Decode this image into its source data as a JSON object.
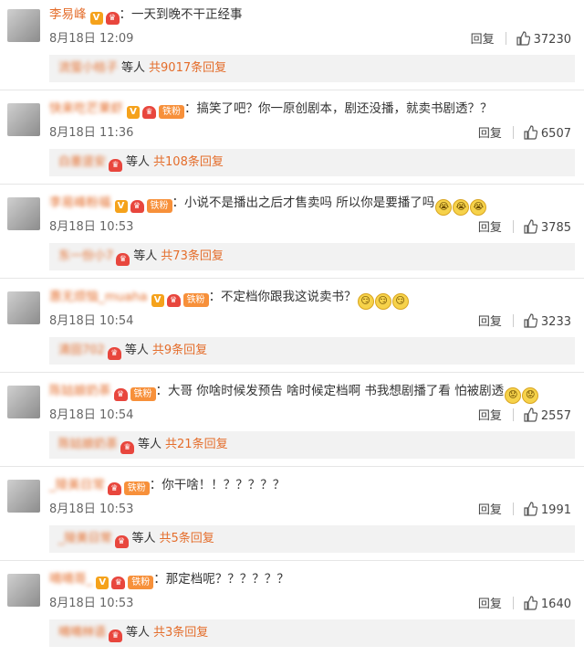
{
  "comments": [
    {
      "username": "李易峰",
      "verified": true,
      "crown": true,
      "tiefen": false,
      "text": "：一天到晚不干正经事",
      "emojis": [],
      "time": "8月18日 12:09",
      "reply_label": "回复",
      "likes": "37230",
      "replies": {
        "name": "流萤小桔子",
        "crown": false,
        "suffix": "等人",
        "count_text": "共9017条回复"
      }
    },
    {
      "username": "快来吃芒果虾",
      "verified": true,
      "crown": true,
      "tiefen": true,
      "text": "：搞笑了吧？你一原创剧本，剧还没播，就卖书剧透？？",
      "emojis": [],
      "time": "8月18日 11:36",
      "reply_label": "回复",
      "likes": "6507",
      "replies": {
        "name": "白墨竖安",
        "crown": true,
        "suffix": "等人",
        "count_text": "共108条回复"
      }
    },
    {
      "username": "李易峰粉福",
      "verified": true,
      "crown": true,
      "tiefen": true,
      "text": "：小说不是播出之后才售卖吗 所以你是要播了吗",
      "emojis": [
        "😭",
        "😭",
        "😭"
      ],
      "time": "8月18日 10:53",
      "reply_label": "回复",
      "likes": "3785",
      "replies": {
        "name": "东一份小7",
        "crown": true,
        "suffix": "等人",
        "count_text": "共73条回复"
      }
    },
    {
      "username": "惠无烦恼_muaha",
      "verified": true,
      "crown": true,
      "tiefen": true,
      "text": "：不定档你跟我这说卖书？",
      "emojis": [
        "😏",
        "😏",
        "😏"
      ],
      "time": "8月18日 10:54",
      "reply_label": "回复",
      "likes": "3233",
      "replies": {
        "name": "清田702",
        "crown": true,
        "suffix": "等人",
        "count_text": "共9条回复"
      }
    },
    {
      "username": "陈姑娘奶茶",
      "verified": false,
      "crown": true,
      "tiefen": true,
      "text": "：大哥 你啥时候发预告 啥时候定档啊 书我想剧播了看 怕被剧透",
      "emojis": [
        "😟",
        "😟"
      ],
      "time": "8月18日 10:54",
      "reply_label": "回复",
      "likes": "2557",
      "replies": {
        "name": "陈姑娘奶茶",
        "crown": true,
        "suffix": "等人",
        "count_text": "共21条回复"
      }
    },
    {
      "username": "_陵美日常",
      "verified": false,
      "crown": true,
      "tiefen": true,
      "text": "：你干啥！！？？？？？",
      "emojis": [],
      "time": "8月18日 10:53",
      "reply_label": "回复",
      "likes": "1991",
      "replies": {
        "name": "_陵美日常",
        "crown": true,
        "suffix": "等人",
        "count_text": "共5条回复"
      }
    },
    {
      "username": "嘀嘀哥_",
      "verified": true,
      "crown": true,
      "tiefen": true,
      "text": "：那定档呢？？？？？？",
      "emojis": [],
      "time": "8月18日 10:53",
      "reply_label": "回复",
      "likes": "1640",
      "replies": {
        "name": "嘀嘀林语",
        "crown": true,
        "suffix": "等人",
        "count_text": "共3条回复"
      }
    }
  ],
  "badges": {
    "verified_glyph": "V",
    "crown_glyph": "♛",
    "tiefen_label": "铁粉"
  },
  "colors": {
    "username": "#e46d2b",
    "reply_count": "#e46d2b",
    "reply_box_bg": "#f2f2f2"
  }
}
